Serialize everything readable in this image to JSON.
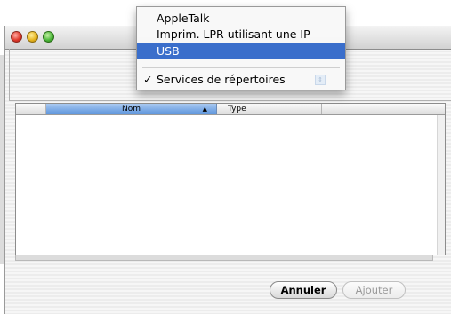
{
  "menu": {
    "items": [
      {
        "label": "AppleTalk",
        "selected": false,
        "checked": false
      },
      {
        "label": "Imprim. LPR utilisant une IP",
        "selected": false,
        "checked": false
      },
      {
        "label": "USB",
        "selected": true,
        "checked": false
      },
      {
        "label": "Services de répertoires",
        "selected": false,
        "checked": true
      }
    ],
    "check_glyph": "✓"
  },
  "table": {
    "columns": [
      "Nom",
      "Type"
    ],
    "sort_indicator": "▲",
    "rows": []
  },
  "buttons": {
    "cancel": "Annuler",
    "add": "Ajouter"
  },
  "colors": {
    "selection": "#3a6ecb",
    "header_selected": "#5b94dc"
  }
}
